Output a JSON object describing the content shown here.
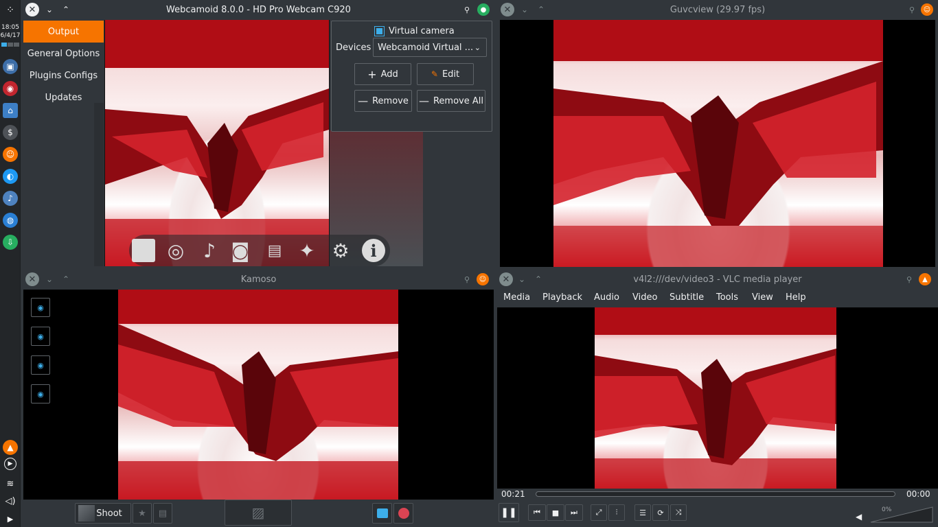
{
  "taskbar": {
    "clock_time": "18:05",
    "clock_date": "6/4/17"
  },
  "webcamoid": {
    "title": "Webcamoid 8.0.0 - HD Pro Webcam C920",
    "sidebar": [
      "Output",
      "General Options",
      "Plugins Configs",
      "Updates"
    ],
    "virtual_camera_label": "Virtual camera",
    "devices_label": "Devices",
    "device_value": "Webcamoid Virtual ...",
    "buttons": {
      "add": "Add",
      "edit": "Edit",
      "remove": "Remove",
      "remove_all": "Remove All"
    }
  },
  "guvcview": {
    "title": "Guvcview (29.97 fps)"
  },
  "kamoso": {
    "title": "Kamoso",
    "shoot_label": "Shoot"
  },
  "vlc": {
    "title": "v4l2:///dev/video3 - VLC media player",
    "menu": [
      "Media",
      "Playback",
      "Audio",
      "Video",
      "Subtitle",
      "Tools",
      "View",
      "Help"
    ],
    "elapsed": "00:21",
    "total": "00:00",
    "volume": "0%"
  },
  "colors": {
    "accent": "#f67400",
    "highlight": "#3daee9",
    "background": "#31363b"
  }
}
